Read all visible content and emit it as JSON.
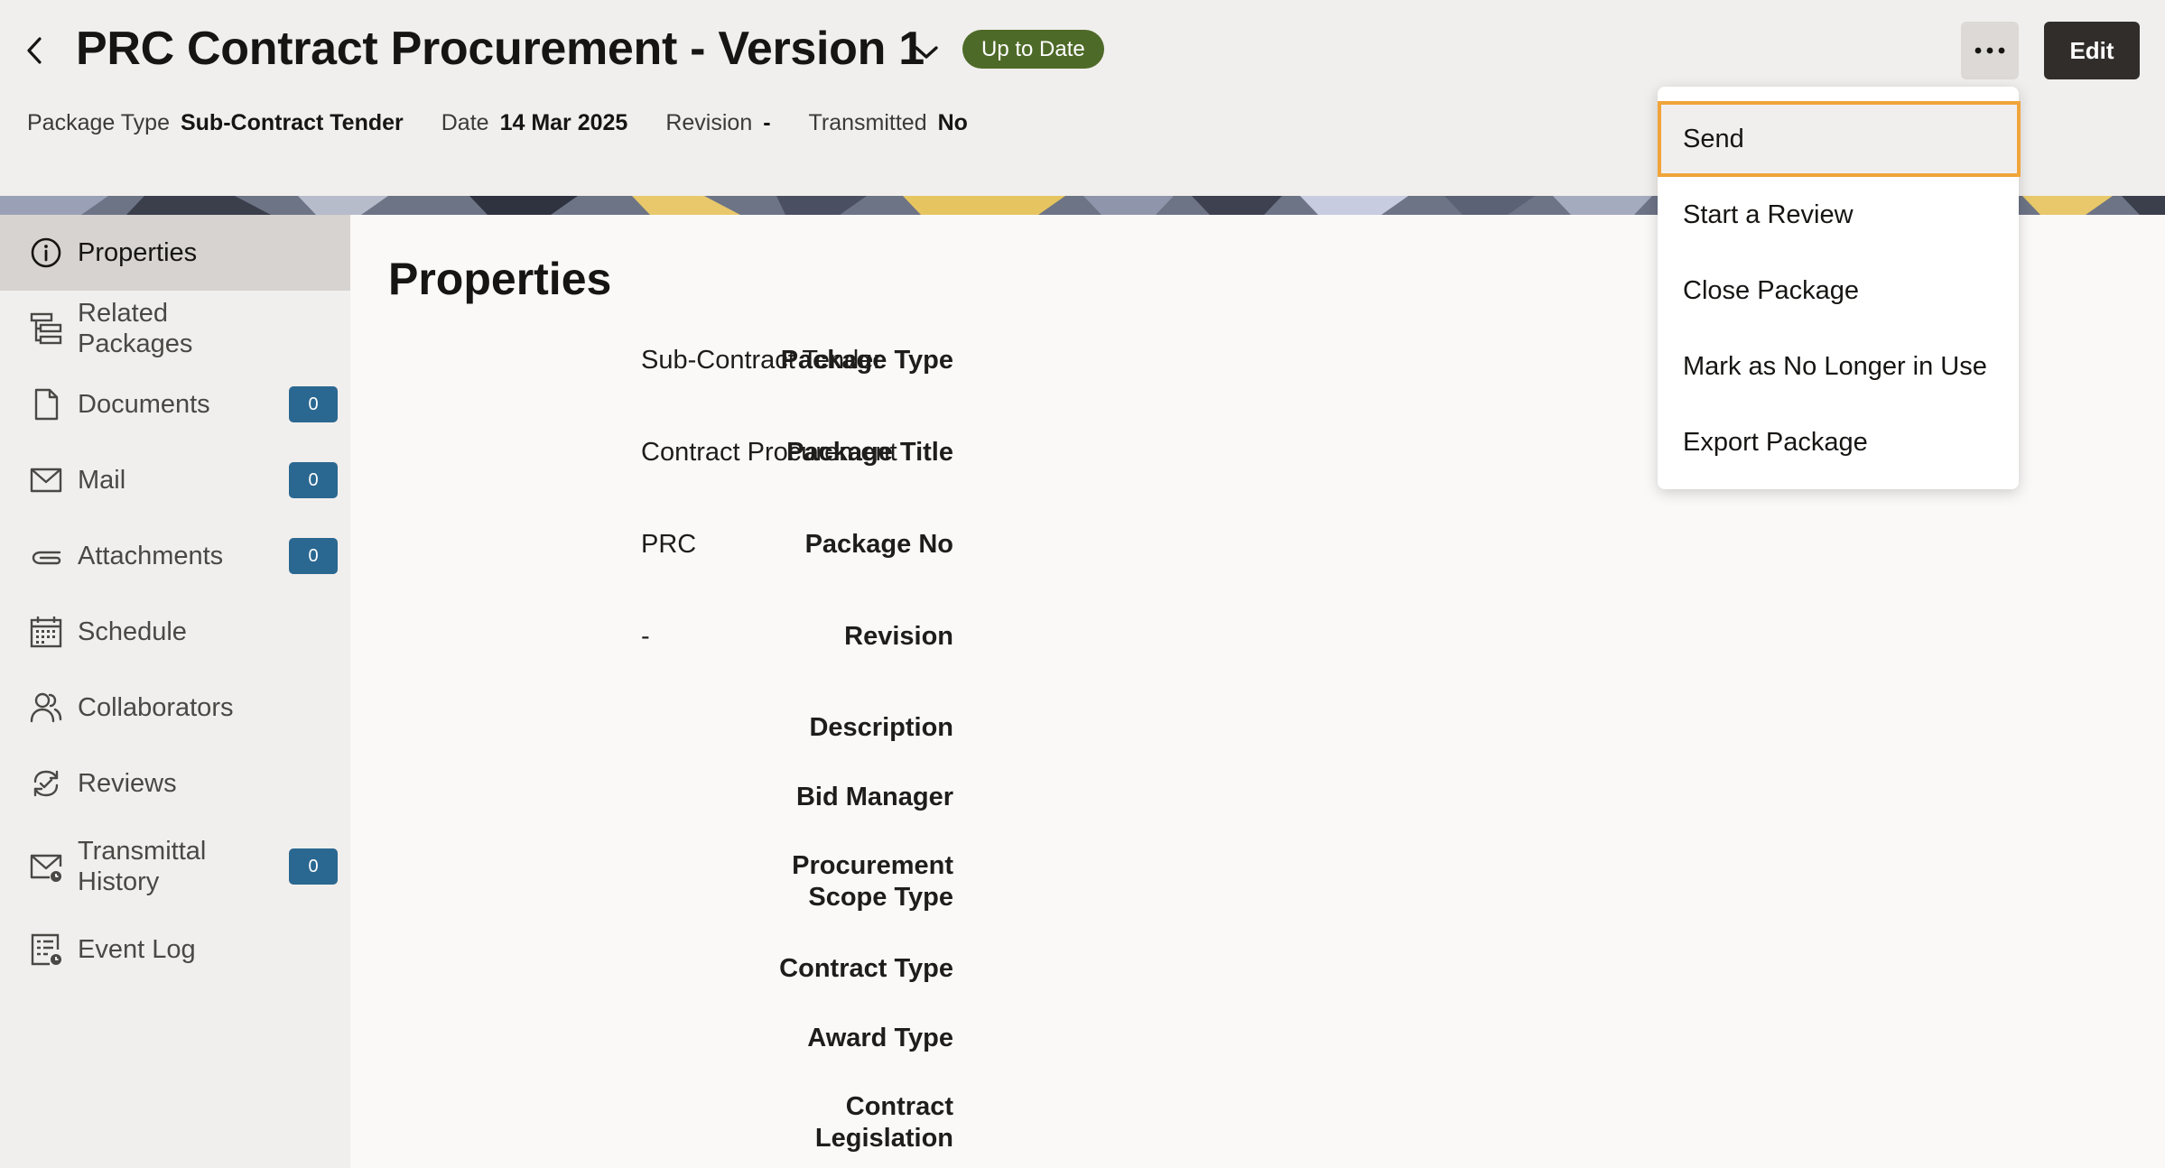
{
  "header": {
    "title": "PRC Contract Procurement - Version 1",
    "status": "Up to Date",
    "edit_label": "Edit",
    "meta": [
      {
        "label": "Package Type",
        "value": "Sub-Contract Tender"
      },
      {
        "label": "Date",
        "value": "14 Mar 2025"
      },
      {
        "label": "Revision",
        "value": "-"
      },
      {
        "label": "Transmitted",
        "value": "No"
      }
    ]
  },
  "sidebar": {
    "items": [
      {
        "label": "Properties",
        "icon": "info-icon",
        "active": true
      },
      {
        "label": "Related Packages",
        "icon": "hierarchy-icon"
      },
      {
        "label": "Documents",
        "icon": "document-icon",
        "count": "0"
      },
      {
        "label": "Mail",
        "icon": "mail-icon",
        "count": "0"
      },
      {
        "label": "Attachments",
        "icon": "paperclip-icon",
        "count": "0"
      },
      {
        "label": "Schedule",
        "icon": "calendar-icon"
      },
      {
        "label": "Collaborators",
        "icon": "users-icon"
      },
      {
        "label": "Reviews",
        "icon": "review-icon"
      },
      {
        "label": "Transmittal History",
        "icon": "mail-clock-icon",
        "count": "0"
      },
      {
        "label": "Event Log",
        "icon": "event-log-icon"
      }
    ]
  },
  "main": {
    "section_title": "Properties",
    "properties": [
      {
        "label": "Package Type",
        "value": "Sub-Contract Tender"
      },
      {
        "label": "Package Title",
        "value": "Contract Procurement"
      },
      {
        "label": "Package No",
        "value": "PRC"
      },
      {
        "label": "Revision",
        "value": "-"
      },
      {
        "label": "Description",
        "value": ""
      },
      {
        "label": "Bid Manager",
        "value": ""
      },
      {
        "label": "Procurement Scope Type",
        "value": ""
      },
      {
        "label": "Contract Type",
        "value": ""
      },
      {
        "label": "Award Type",
        "value": ""
      },
      {
        "label": "Contract Legislation",
        "value": ""
      }
    ]
  },
  "menu": {
    "items": [
      "Send",
      "Start a Review",
      "Close Package",
      "Mark as No Longer in Use",
      "Export Package"
    ],
    "focused": "Send"
  },
  "colors": {
    "status_badge": "#4e6a28",
    "count_badge": "#2b6891",
    "edit_button": "#312d2a",
    "focus_ring": "#f0a43a",
    "active_nav": "#d6d3d0"
  }
}
